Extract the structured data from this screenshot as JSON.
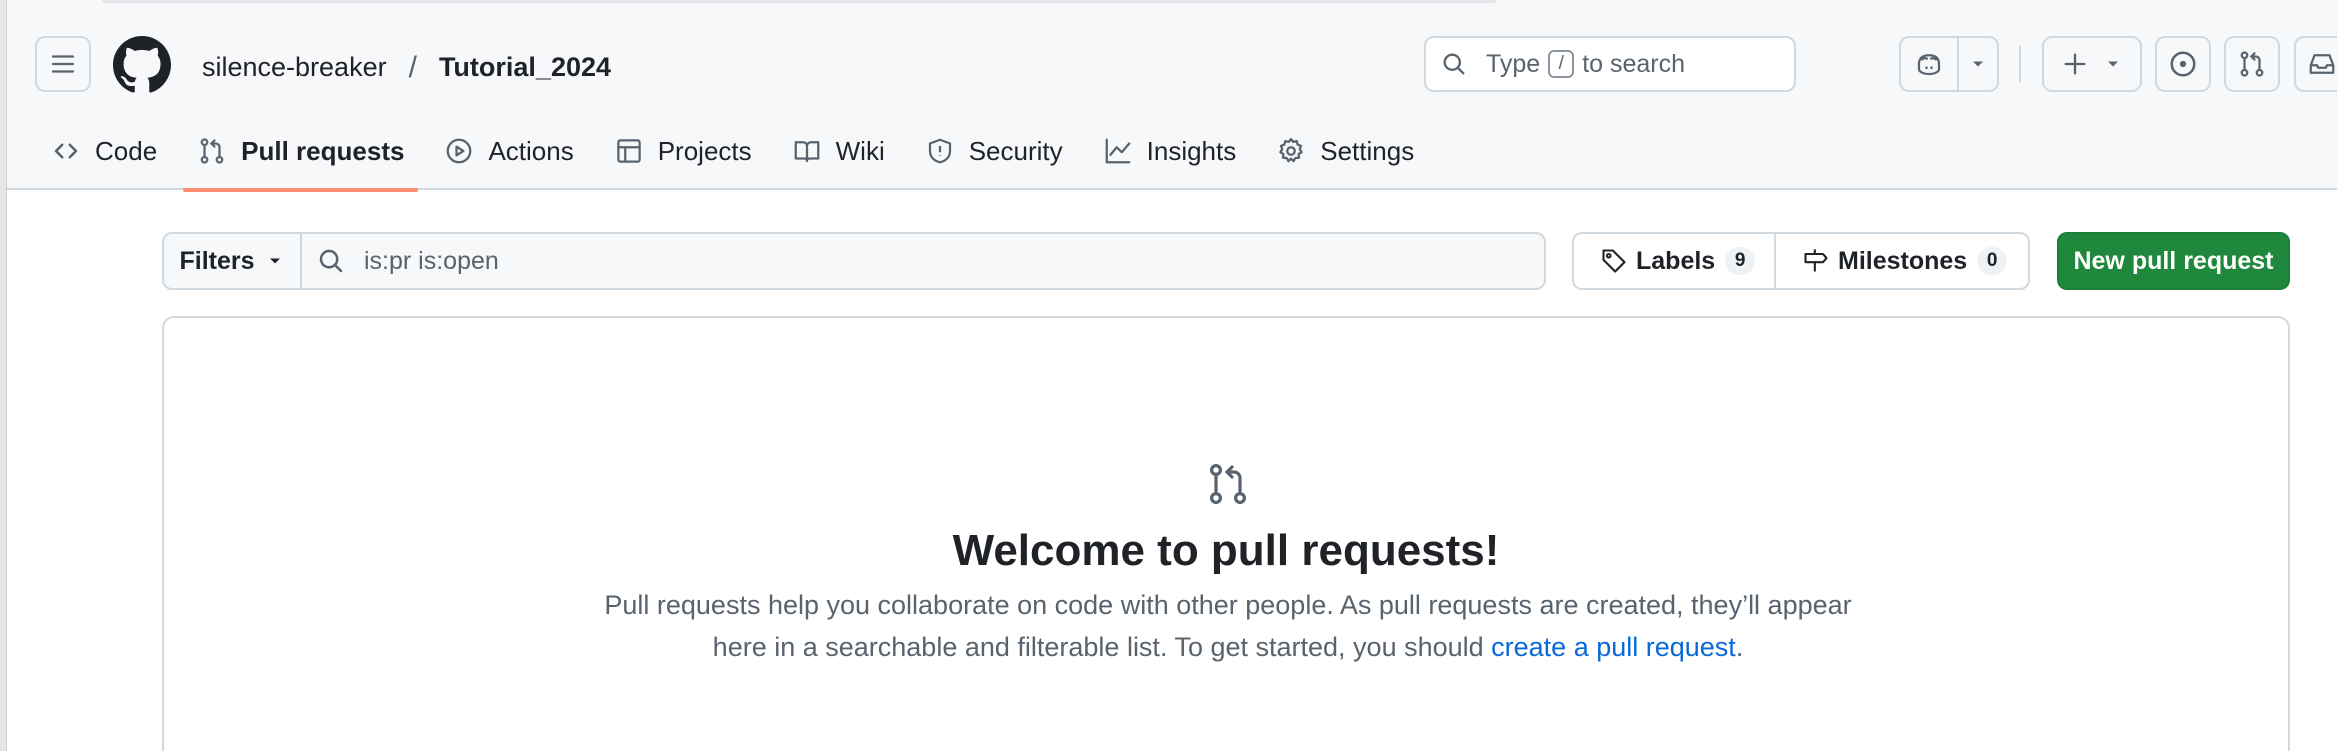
{
  "header": {
    "owner": "silence-breaker",
    "separator": "/",
    "repo": "Tutorial_2024",
    "search": {
      "prefix": "Type",
      "key": "/",
      "suffix": "to search"
    }
  },
  "icons": {
    "menu": "hamburger-icon",
    "logo": "github-mark-icon",
    "search": "search-icon",
    "copilot": "copilot-icon",
    "create": "plus-icon",
    "issues": "issue-opened-icon",
    "pulls": "git-pull-request-icon",
    "inbox": "inbox-icon"
  },
  "nav": {
    "tabs": [
      {
        "label": "Code",
        "icon": "code-icon"
      },
      {
        "label": "Pull requests",
        "icon": "git-pull-request-icon",
        "active": true
      },
      {
        "label": "Actions",
        "icon": "play-icon"
      },
      {
        "label": "Projects",
        "icon": "table-icon"
      },
      {
        "label": "Wiki",
        "icon": "book-icon"
      },
      {
        "label": "Security",
        "icon": "shield-icon"
      },
      {
        "label": "Insights",
        "icon": "graph-icon"
      },
      {
        "label": "Settings",
        "icon": "gear-icon"
      }
    ]
  },
  "toolbar": {
    "filters_label": "Filters",
    "filter_query": "is:pr is:open",
    "labels_label": "Labels",
    "labels_count": "9",
    "milestones_label": "Milestones",
    "milestones_count": "0",
    "new_pr_label": "New pull request"
  },
  "blankslate": {
    "title": "Welcome to pull requests!",
    "text_1": "Pull requests help you collaborate on code with other people. As pull requests are created, they’ll appear here in a searchable and filterable list. To get started, you should ",
    "link": "create a pull request",
    "text_2": "."
  },
  "colors": {
    "accent_green": "#1f883d",
    "link_blue": "#0969da",
    "active_underline": "#fd8c73",
    "header_bg": "#f6f8fa",
    "border": "#d1d9e0"
  }
}
